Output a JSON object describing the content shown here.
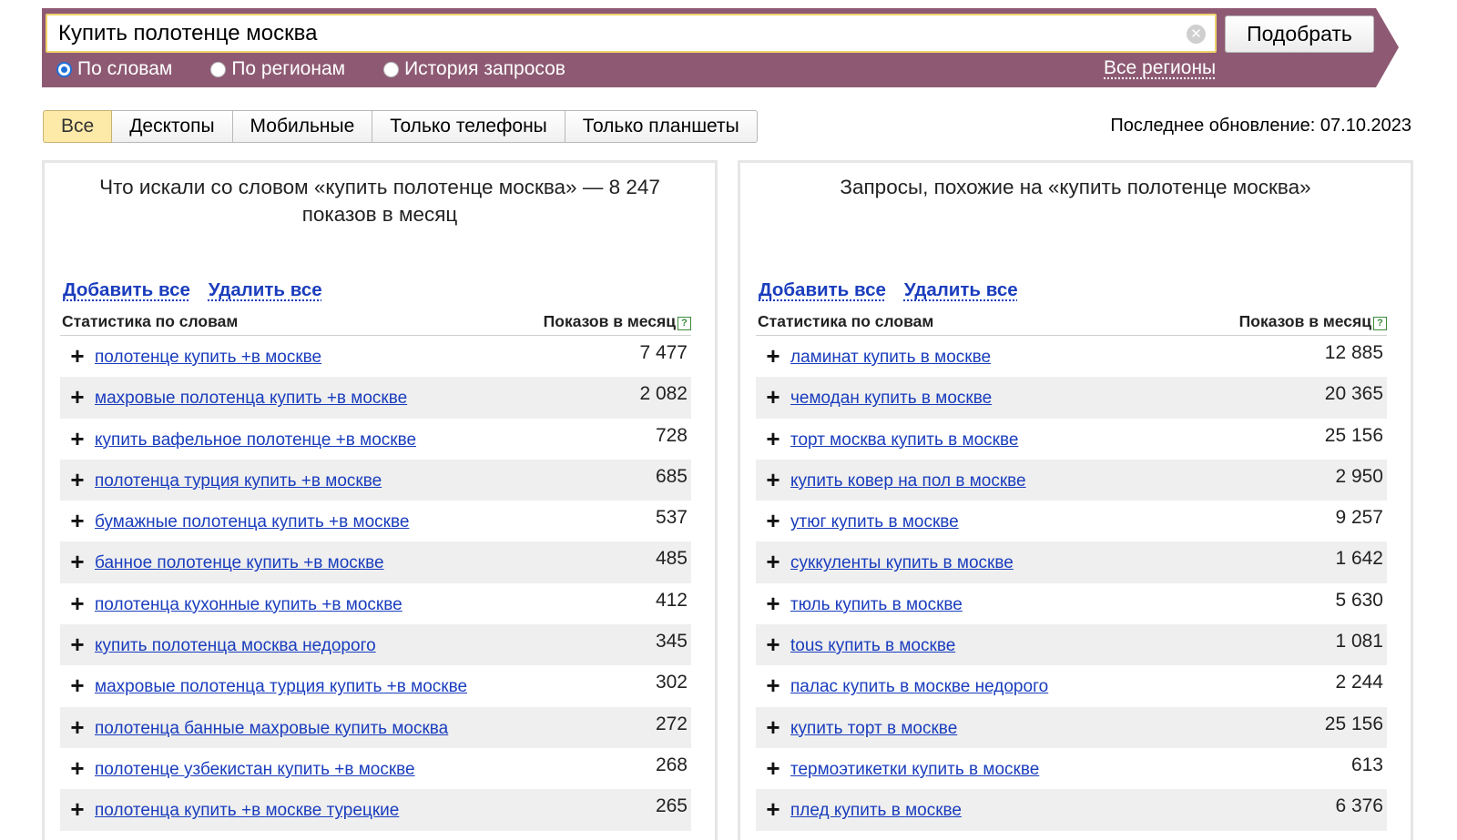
{
  "search": {
    "query": "Купить полотенце москва",
    "submit_label": "Подобрать",
    "modes": [
      {
        "label": "По словам",
        "checked": true
      },
      {
        "label": "По регионам",
        "checked": false
      },
      {
        "label": "История запросов",
        "checked": false
      }
    ],
    "regions_link": "Все регионы"
  },
  "tabs": [
    "Все",
    "Десктопы",
    "Мобильные",
    "Только телефоны",
    "Только планшеты"
  ],
  "active_tab": 0,
  "last_update": "Последнее обновление: 07.10.2023",
  "left_panel": {
    "title": "Что искали со словом «купить полотенце москва» — 8 247 показов в месяц",
    "add_all": "Добавить все",
    "remove_all": "Удалить все",
    "col_words": "Статистика по словам",
    "col_count": "Показов в месяц",
    "rows": [
      {
        "kw": "полотенце купить +в москве",
        "count": "7 477"
      },
      {
        "kw": "махровые полотенца купить +в москве",
        "count": "2 082"
      },
      {
        "kw": "купить вафельное полотенце +в москве",
        "count": "728"
      },
      {
        "kw": "полотенца турция купить +в москве",
        "count": "685"
      },
      {
        "kw": "бумажные полотенца купить +в москве",
        "count": "537"
      },
      {
        "kw": "банное полотенце купить +в москве",
        "count": "485"
      },
      {
        "kw": "полотенца кухонные купить +в москве",
        "count": "412"
      },
      {
        "kw": "купить полотенца москва недорого",
        "count": "345"
      },
      {
        "kw": "махровые полотенца турция купить +в москве",
        "count": "302"
      },
      {
        "kw": "полотенца банные махровые купить москва",
        "count": "272"
      },
      {
        "kw": "полотенце узбекистан купить +в москве",
        "count": "268"
      },
      {
        "kw": "полотенца купить +в москве турецкие",
        "count": "265"
      }
    ]
  },
  "right_panel": {
    "title": "Запросы, похожие на «купить полотенце москва»",
    "add_all": "Добавить все",
    "remove_all": "Удалить все",
    "col_words": "Статистика по словам",
    "col_count": "Показов в месяц",
    "rows": [
      {
        "kw": "ламинат купить в москве",
        "count": "12 885"
      },
      {
        "kw": "чемодан купить в москве",
        "count": "20 365"
      },
      {
        "kw": "торт москва купить в москве",
        "count": "25 156"
      },
      {
        "kw": "купить ковер на пол в москве",
        "count": "2 950"
      },
      {
        "kw": "утюг купить в москве",
        "count": "9 257"
      },
      {
        "kw": "суккуленты купить в москве",
        "count": "1 642"
      },
      {
        "kw": "тюль купить в москве",
        "count": "5 630"
      },
      {
        "kw": "tous купить в москве",
        "count": "1 081"
      },
      {
        "kw": "палас купить в москве недорого",
        "count": "2 244"
      },
      {
        "kw": "купить торт в москве",
        "count": "25 156"
      },
      {
        "kw": "термоэтикетки купить в москве",
        "count": "613"
      },
      {
        "kw": "плед купить в москве",
        "count": "6 376"
      }
    ]
  },
  "icons": {
    "clear": "clear-icon",
    "add": "plus-icon",
    "help": "help-icon"
  }
}
